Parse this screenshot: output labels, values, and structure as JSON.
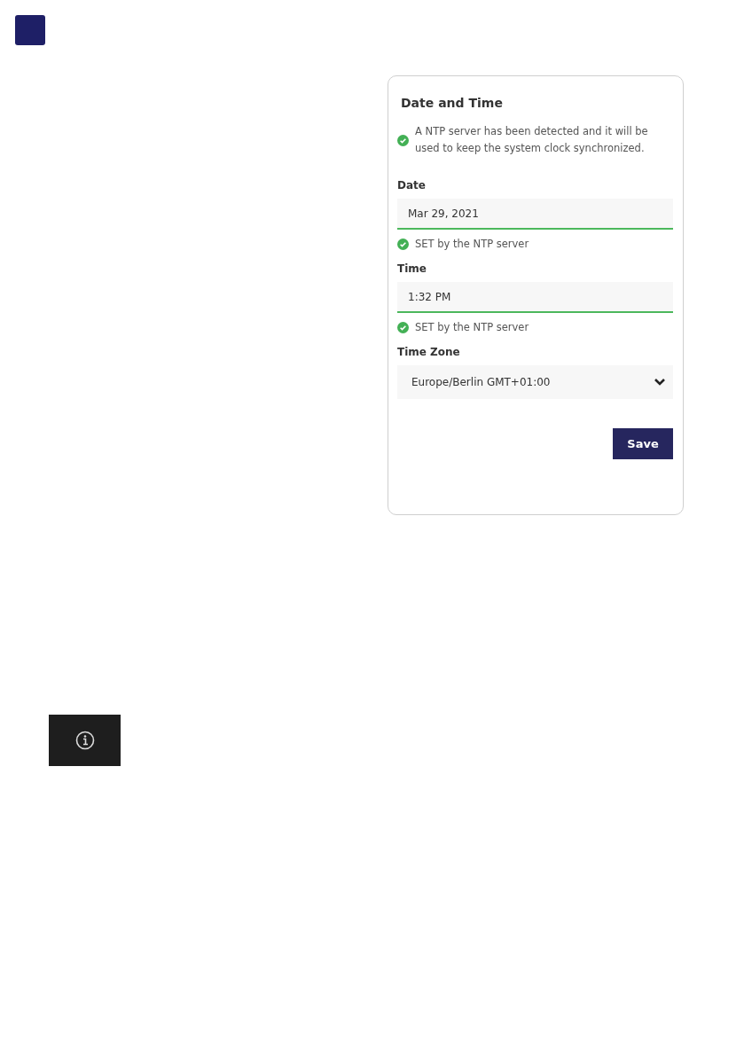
{
  "card": {
    "title": "Date and Time",
    "notice": "A NTP server has been detected and it will be used to keep the system clock synchronized.",
    "fields": [
      {
        "kind": "input",
        "label": "Date",
        "value": "Mar 29, 2021",
        "hint": "SET by the NTP server"
      },
      {
        "kind": "input",
        "label": "Time",
        "value": "1:32 PM",
        "hint": "SET by the NTP server"
      },
      {
        "kind": "select",
        "label": "Time Zone",
        "value": "Europe/Berlin GMT+01:00"
      }
    ],
    "button": "Save"
  }
}
